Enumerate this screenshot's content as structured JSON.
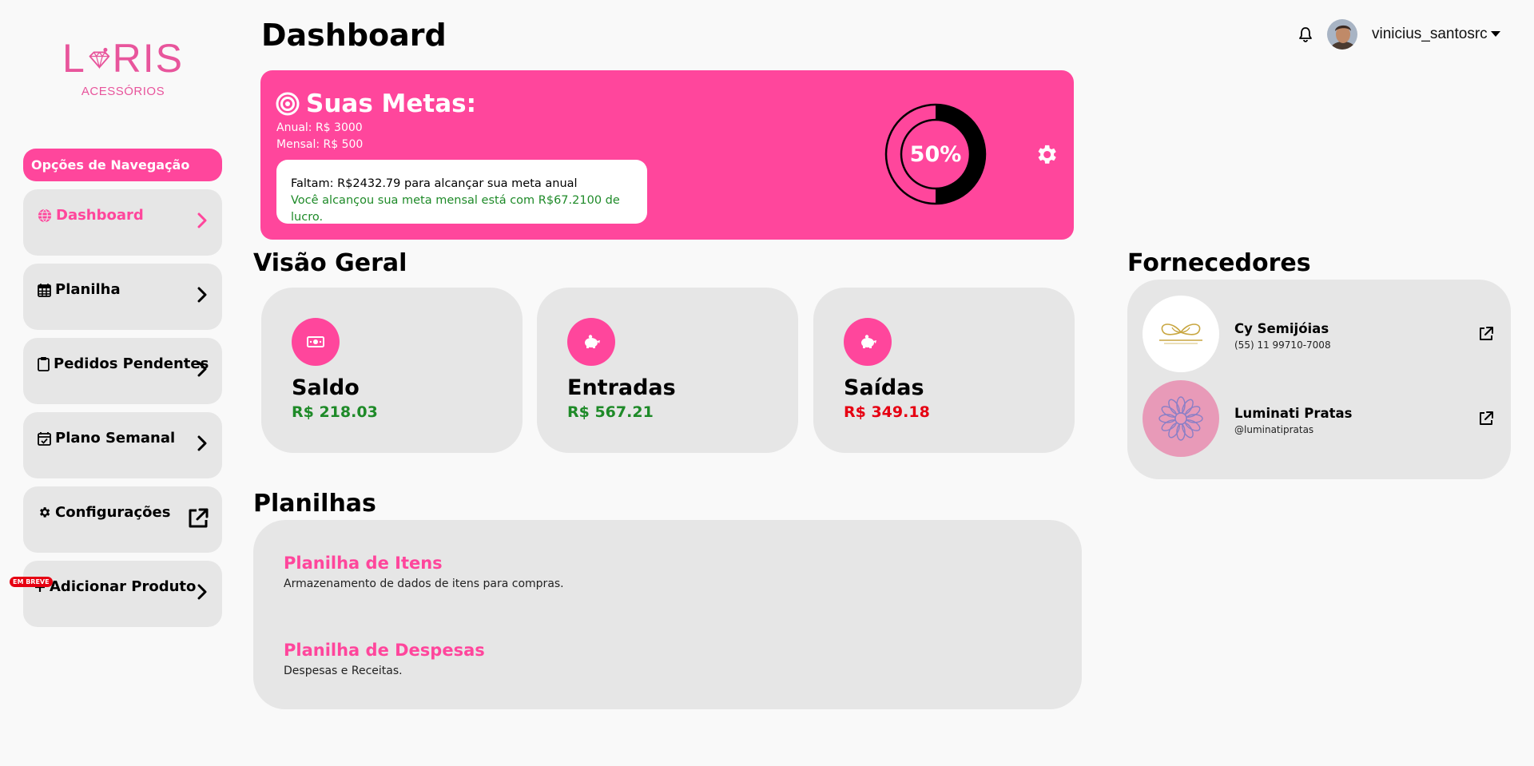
{
  "brand": {
    "name": "LORIS",
    "subtitle": "ACESSÓRIOS",
    "color": "#e8559c"
  },
  "sidebar": {
    "heading": "Opções de Navegação",
    "items": [
      {
        "label": "Dashboard",
        "icon": "globe-icon",
        "trailing": "chevron-right-icon",
        "active": true
      },
      {
        "label": "Planilha",
        "icon": "calendar-grid-icon",
        "trailing": "chevron-right-icon"
      },
      {
        "label": "Pedidos Pendentes",
        "icon": "clipboard-icon",
        "trailing": "chevron-right-icon"
      },
      {
        "label": "Plano Semanal",
        "icon": "calendar-check-icon",
        "trailing": "chevron-right-icon"
      },
      {
        "label": "Configurações",
        "icon": "gear-icon",
        "trailing": "external-link-icon"
      },
      {
        "label": "Adicionar Produto",
        "icon": "plus-icon",
        "trailing": "chevron-right-icon",
        "badge": "EM BREVE"
      }
    ]
  },
  "header": {
    "title": "Dashboard",
    "username": "vinicius_santosrc",
    "icons": [
      "bell-icon",
      "avatar",
      "caret-down-icon"
    ]
  },
  "goals": {
    "title": "Suas Metas:",
    "annual": "Anual: R$ 3000",
    "monthly": "Mensal: R$ 500",
    "remaining": "Faltam: R$2432.79 para alcançar sua meta anual",
    "achieved": "Você alcançou sua meta mensal está com R$67.2100 de lucro.",
    "progress_label": "50%",
    "progress": 0.5
  },
  "overview": {
    "title": "Visão Geral",
    "cards": [
      {
        "label": "Saldo",
        "value": "R$ 218.03",
        "icon": "money-icon",
        "status": "positive"
      },
      {
        "label": "Entradas",
        "value": "R$ 567.21",
        "icon": "piggy-bank-icon",
        "status": "positive"
      },
      {
        "label": "Saídas",
        "value": "R$ 349.18",
        "icon": "piggy-bank-icon",
        "status": "negative"
      }
    ]
  },
  "sheets": {
    "title": "Planilhas",
    "items": [
      {
        "title": "Planilha de Itens",
        "description": "Armazenamento de dados de itens para compras."
      },
      {
        "title": "Planilha de Despesas",
        "description": "Despesas e Receitas."
      }
    ]
  },
  "suppliers": {
    "title": "Fornecedores",
    "items": [
      {
        "name": "Cy Semijóias",
        "contact": "(55) 11 99710-7008"
      },
      {
        "name": "Luminati Pratas",
        "contact": "@luminatipratas"
      }
    ]
  },
  "colors": {
    "accent": "#ff469c",
    "card": "#e6e6e6",
    "positive": "#1e8a28",
    "negative": "#e60012"
  }
}
